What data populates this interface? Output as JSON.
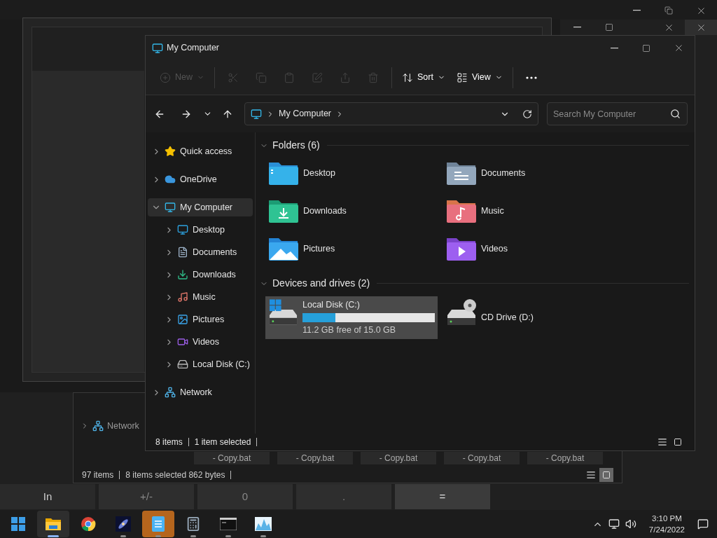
{
  "main_window": {
    "title": "My Computer",
    "toolbar": [
      {
        "kind": "new",
        "label": "New",
        "disabled": true
      },
      {
        "kind": "cut",
        "disabled": true
      },
      {
        "kind": "copy",
        "disabled": true
      },
      {
        "kind": "paste",
        "disabled": true
      },
      {
        "kind": "rename",
        "disabled": true
      },
      {
        "kind": "share",
        "disabled": true
      },
      {
        "kind": "delete",
        "disabled": true
      },
      {
        "kind": "sort",
        "label": "Sort",
        "disabled": false
      },
      {
        "kind": "view",
        "label": "View",
        "disabled": false
      },
      {
        "kind": "more",
        "disabled": false
      }
    ],
    "address": {
      "path": [
        "My Computer"
      ]
    },
    "search": {
      "placeholder": "Search My Computer"
    },
    "sidebar": [
      {
        "kind": "quick",
        "label": "Quick access",
        "expanded": false,
        "selected": false
      },
      {
        "kind": "cloud",
        "label": "OneDrive",
        "expanded": false,
        "selected": false
      },
      {
        "kind": "pc",
        "label": "My Computer",
        "expanded": true,
        "selected": true,
        "children": [
          {
            "kind": "desktop",
            "label": "Desktop",
            "expanded": false,
            "selected": false
          },
          {
            "kind": "documents",
            "label": "Documents",
            "expanded": false,
            "selected": false
          },
          {
            "kind": "downloads",
            "label": "Downloads",
            "expanded": false,
            "selected": false
          },
          {
            "kind": "music",
            "label": "Music",
            "expanded": false,
            "selected": false
          },
          {
            "kind": "pictures",
            "label": "Pictures",
            "expanded": false,
            "selected": false
          },
          {
            "kind": "videos",
            "label": "Videos",
            "expanded": false,
            "selected": false
          },
          {
            "kind": "disk",
            "label": "Local Disk (C:)",
            "expanded": false,
            "selected": false
          }
        ]
      },
      {
        "kind": "network",
        "label": "Network",
        "expanded": false,
        "selected": false
      }
    ],
    "sections": [
      {
        "title": "Folders (6)",
        "expanded": true,
        "items": [
          {
            "kind": "desktop",
            "name": "Desktop",
            "selected": false
          },
          {
            "kind": "documents",
            "name": "Documents",
            "selected": false
          },
          {
            "kind": "downloads",
            "name": "Downloads",
            "selected": false
          },
          {
            "kind": "music",
            "name": "Music",
            "selected": false
          },
          {
            "kind": "pictures",
            "name": "Pictures",
            "selected": false
          },
          {
            "kind": "videos",
            "name": "Videos",
            "selected": false
          }
        ]
      },
      {
        "title": "Devices and drives (2)",
        "expanded": true,
        "items": [
          {
            "kind": "disk",
            "name": "Local Disk (C:)",
            "selected": true,
            "level": 0.25,
            "reading": "11.2 GB free of 15.0 GB"
          },
          {
            "kind": "cd",
            "name": "CD Drive (D:)",
            "selected": false
          }
        ]
      }
    ],
    "status": [
      "8 items",
      "1 item selected"
    ],
    "view_buttons": [
      {
        "kind": "details",
        "selected": false
      },
      {
        "kind": "tiles",
        "selected": false
      }
    ]
  },
  "background_explorer": {
    "sidebar_item": "Network",
    "files": [
      "- Copy.bat",
      "- Copy.bat",
      "- Copy.bat",
      "- Copy.bat",
      "- Copy.bat"
    ],
    "status": [
      "97 items",
      "8 items selected 862 bytes"
    ],
    "view_buttons": [
      {
        "kind": "details",
        "selected": false
      },
      {
        "kind": "tiles",
        "selected": true
      }
    ]
  },
  "calculator_keys": [
    {
      "label": "In",
      "kind": "function"
    },
    {
      "label": "+/-",
      "kind": "number"
    },
    {
      "label": "0",
      "kind": "number"
    },
    {
      "label": ".",
      "kind": "number"
    },
    {
      "label": "=",
      "kind": "equals"
    }
  ],
  "taskbar": {
    "apps": [
      {
        "kind": "start",
        "selected": false,
        "running": false,
        "flashing": false
      },
      {
        "kind": "explorer",
        "selected": true,
        "running": true,
        "flashing": false
      },
      {
        "kind": "browser",
        "selected": false,
        "running": false,
        "flashing": false
      },
      {
        "kind": "galaxy",
        "selected": false,
        "running": true,
        "flashing": false
      },
      {
        "kind": "notepad",
        "selected": false,
        "running": true,
        "flashing": true
      },
      {
        "kind": "calculator",
        "selected": false,
        "running": true,
        "flashing": false
      },
      {
        "kind": "terminal",
        "selected": false,
        "running": true,
        "flashing": false
      },
      {
        "kind": "monitor",
        "selected": false,
        "running": true,
        "flashing": false
      }
    ],
    "time": "3:10 PM",
    "date": "7/24/2022"
  }
}
